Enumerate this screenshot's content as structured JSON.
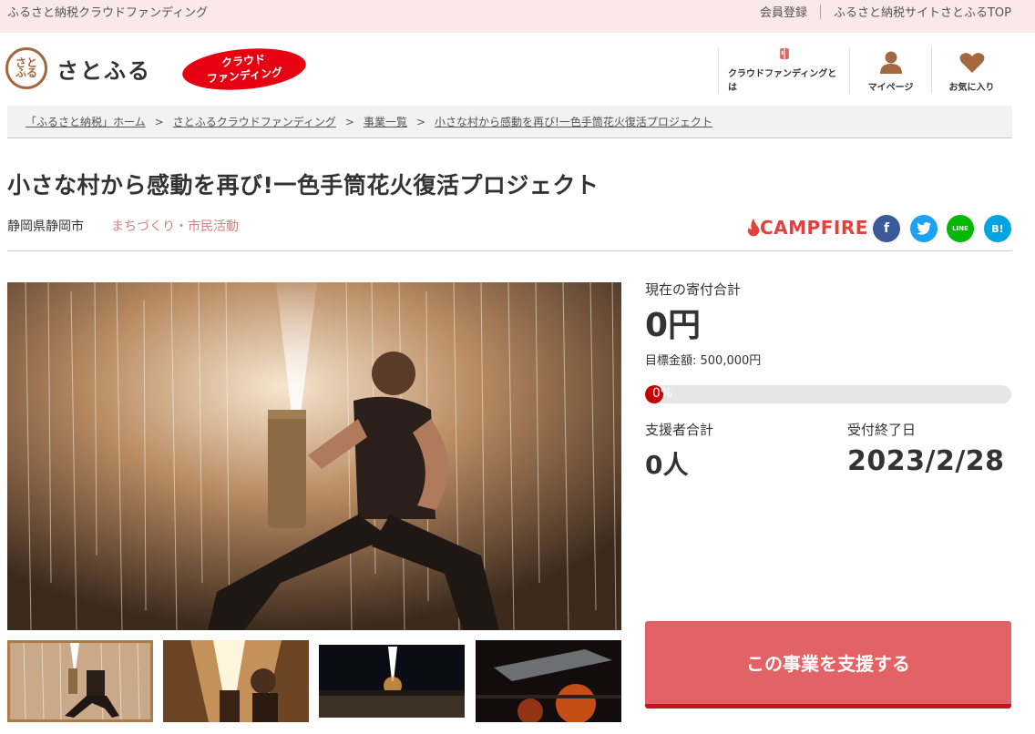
{
  "topbar": {
    "site_name": "ふるさと納税クラウドファンディング",
    "register_link": "会員登録",
    "top_link": "ふるさと納税サイトさとふるTOP"
  },
  "header": {
    "logo_mark": "さと ふる",
    "logo_text": "さとふる",
    "badge_line1": "クラウド",
    "badge_line2": "ファンディング",
    "nav": {
      "about": "クラウドファンディングとは",
      "mypage": "マイページ",
      "favorites": "お気に入り"
    }
  },
  "breadcrumb": [
    "「ふるさと納税」ホーム",
    "さとふるクラウドファンディング",
    "事業一覧",
    "小さな村から感動を再び!一色手筒花火復活プロジェクト"
  ],
  "project": {
    "title": "小さな村から感動を再び!一色手筒花火復活プロジェクト",
    "location": "静岡県静岡市",
    "category": "まちづくり・市民活動",
    "partner": "CAMPFIRE"
  },
  "share": {
    "facebook": "f",
    "line": "LINE",
    "hatena": "B!"
  },
  "stats": {
    "current_label": "現在の寄付合計",
    "current_amount": "0円",
    "goal_text": "目標金額: 500,000円",
    "progress_text": "0%",
    "progress_value": 0,
    "supporters_label": "支援者合計",
    "supporters_value": "0人",
    "deadline_label": "受付終了日",
    "deadline_value": "2023/2/28"
  },
  "cta": {
    "support_label": "この事業を支援する"
  },
  "icons": {
    "about": "book-icon",
    "mypage": "person-icon",
    "favorites": "heart-icon"
  },
  "colors": {
    "accent": "#e26266",
    "badge_red": "#e60012",
    "category": "#d57f82",
    "icon_brown": "#a5673f"
  }
}
